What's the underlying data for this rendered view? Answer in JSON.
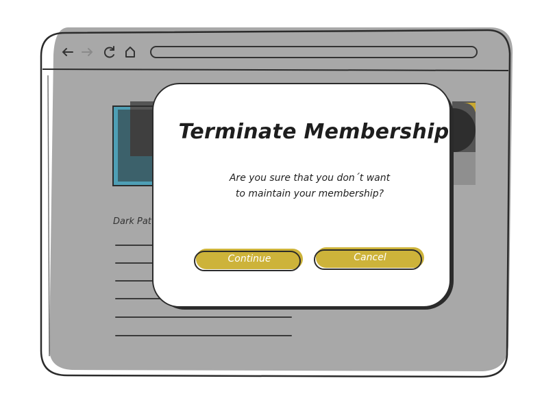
{
  "browser": {
    "nav": {
      "back_icon": "arrow-left-icon",
      "forward_icon": "arrow-right-icon",
      "reload_icon": "reload-icon",
      "home_icon": "home-icon"
    },
    "address_bar": {
      "value": ""
    }
  },
  "page": {
    "caption": "Dark Pat"
  },
  "dialog": {
    "title": "Terminate Membership",
    "message_line1": "Are you sure that you don´t want",
    "message_line2": "to maintain your membership?",
    "continue_label": "Continue",
    "cancel_label": "Cancel"
  },
  "colors": {
    "window_fill": "#a8a8a8",
    "button_fill": "#cdb33a",
    "image_blue": "#4f9fb5",
    "image_dark": "#555555",
    "image_gold": "#c9a830",
    "outline": "#2b2b2b"
  }
}
